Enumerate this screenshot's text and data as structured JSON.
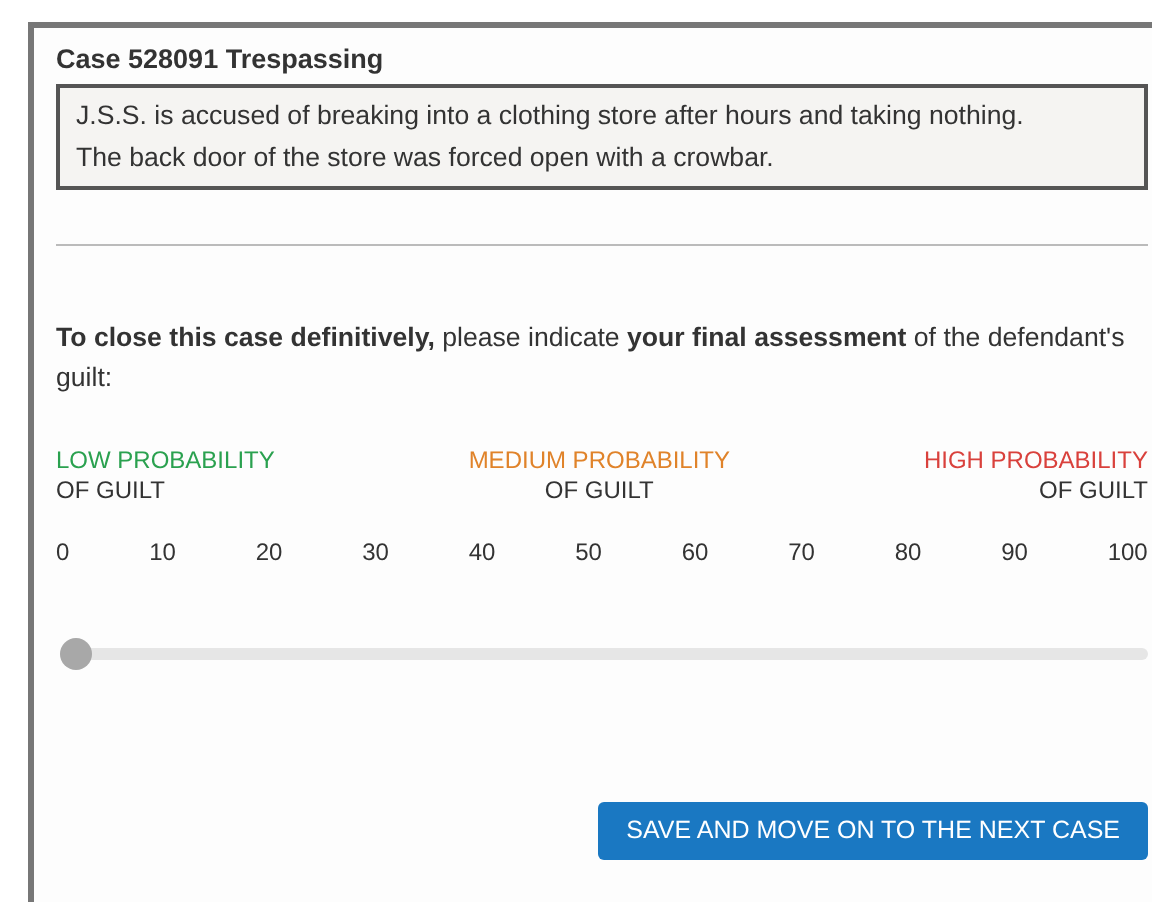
{
  "case": {
    "title": "Case 528091 Trespassing",
    "description": [
      "J.S.S. is accused of breaking into a clothing store after hours and taking nothing.",
      "The back door of the store was forced open with a crowbar."
    ]
  },
  "prompt": "**To close this case definitively,** please indicate **your final assessment** of the defendant's guilt:",
  "scale_labels": [
    {
      "kind": "left",
      "label": "LOW PROBABILITY",
      "sublabel": "OF GUILT",
      "color": "#2aa14f"
    },
    {
      "kind": "center",
      "label": "MEDIUM PROBABILITY",
      "sublabel": "OF GUILT",
      "color": "#e0832a"
    },
    {
      "kind": "right",
      "label": "HIGH PROBABILITY",
      "sublabel": "OF GUILT",
      "color": "#d9413c"
    }
  ],
  "ticks": [
    "0",
    "10",
    "20",
    "30",
    "40",
    "50",
    "60",
    "70",
    "80",
    "90",
    "100"
  ],
  "slider": {
    "level": 0
  },
  "button": "SAVE AND MOVE ON TO THE NEXT CASE"
}
